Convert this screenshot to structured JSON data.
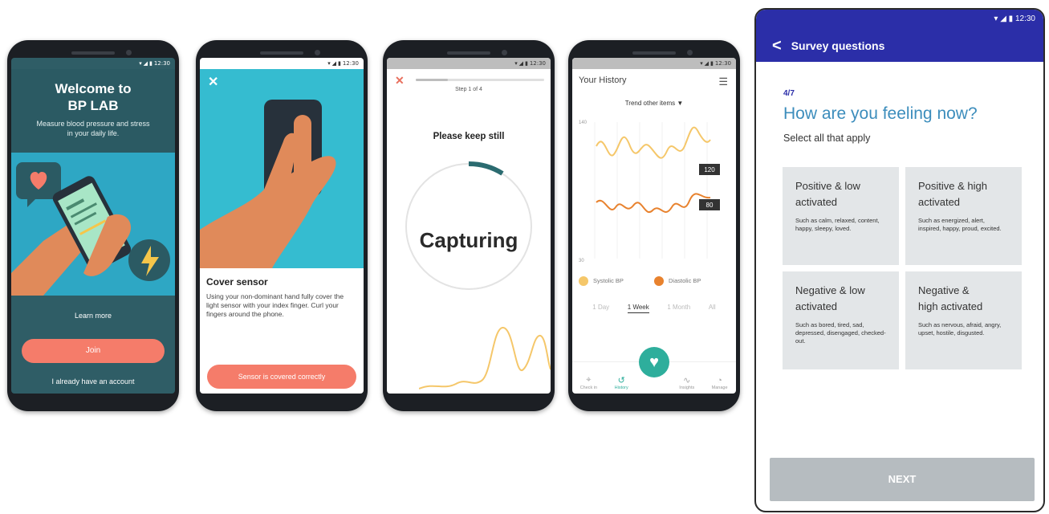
{
  "phone1": {
    "time": "12:30",
    "title": "Welcome to\nBP LAB",
    "subtitle": "Measure blood pressure and stress\nin your daily life.",
    "learn_more": "Learn more",
    "join": "Join",
    "account": "I already have an account"
  },
  "phone2": {
    "time": "12:30",
    "heading": "Cover sensor",
    "body": "Using your non-dominant hand fully cover the light sensor with your index finger. Curl your fingers around the phone.",
    "button": "Sensor is covered correctly"
  },
  "phone3": {
    "time": "12:30",
    "step": "Step 1 of 4",
    "progress_fraction": 0.25,
    "instruction": "Please keep still",
    "status": "Capturing"
  },
  "phone4": {
    "time": "12:30",
    "title": "Your History",
    "trend": "Trend other items",
    "y_top": "140",
    "y_bottom": "30",
    "systolic_value": "120",
    "diastolic_value": "80",
    "legend_systolic": "Systolic BP",
    "legend_diastolic": "Diastolic BP",
    "ranges": [
      "1 Day",
      "1 Week",
      "1 Month",
      "All"
    ],
    "nav": [
      "Check in",
      "History",
      "Insights",
      "Manage"
    ],
    "colors": {
      "systolic": "#f5c76a",
      "diastolic": "#e8822e",
      "accent": "#2eae9c"
    }
  },
  "survey": {
    "time": "12:30",
    "header": "Survey questions",
    "count": "4/7",
    "question": "How are you feeling now?",
    "instruction": "Select all that apply",
    "cards": [
      {
        "title": "Positive & low\nactivated",
        "desc": "Such as calm, relaxed, content, happy, sleepy, loved."
      },
      {
        "title": "Positive & high\nactivated",
        "desc": "Such as energized, alert, inspired, happy, proud, excited."
      },
      {
        "title": "Negative & low\nactivated",
        "desc": "Such as bored, tired, sad, depressed, disengaged, checked-out."
      },
      {
        "title": "Negative &\nhigh activated",
        "desc": "Such as nervous, afraid, angry, upset, hostile, disgusted."
      }
    ],
    "next": "NEXT",
    "colors": {
      "primary": "#2b2ea8",
      "question": "#3c8dbc",
      "card": "#e3e6e8",
      "button": "#b6bcc0"
    }
  }
}
